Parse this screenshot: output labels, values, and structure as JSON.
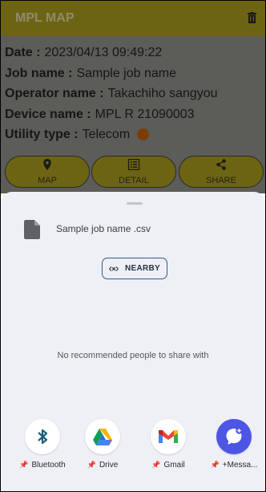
{
  "app": {
    "title": "MPL MAP",
    "fields": [
      {
        "label": "Date :",
        "value": "2023/04/13 09:49:22"
      },
      {
        "label": "Job name :",
        "value": "Sample job name"
      },
      {
        "label": "Operator name :",
        "value": "Takachiho sangyou"
      },
      {
        "label": "Device name :",
        "value": "MPL R 21090003"
      },
      {
        "label": "Utility type :",
        "value": "Telecom"
      }
    ],
    "utility_color": "#e07a0a",
    "nav": [
      {
        "label": "MAP",
        "icon": "map-pin-icon"
      },
      {
        "label": "DETAIL",
        "icon": "list-icon"
      },
      {
        "label": "SHARE",
        "icon": "share-icon"
      }
    ]
  },
  "share_sheet": {
    "file_name": "Sample job name .csv",
    "nearby_label": "NEARBY",
    "empty_message": "No recommended people to share with",
    "targets": [
      {
        "name": "Bluetooth",
        "icon": "bluetooth-icon"
      },
      {
        "name": "Drive",
        "icon": "google-drive-icon"
      },
      {
        "name": "Gmail",
        "icon": "gmail-icon"
      },
      {
        "name": "+Messa...",
        "icon": "messenger-icon"
      }
    ]
  }
}
